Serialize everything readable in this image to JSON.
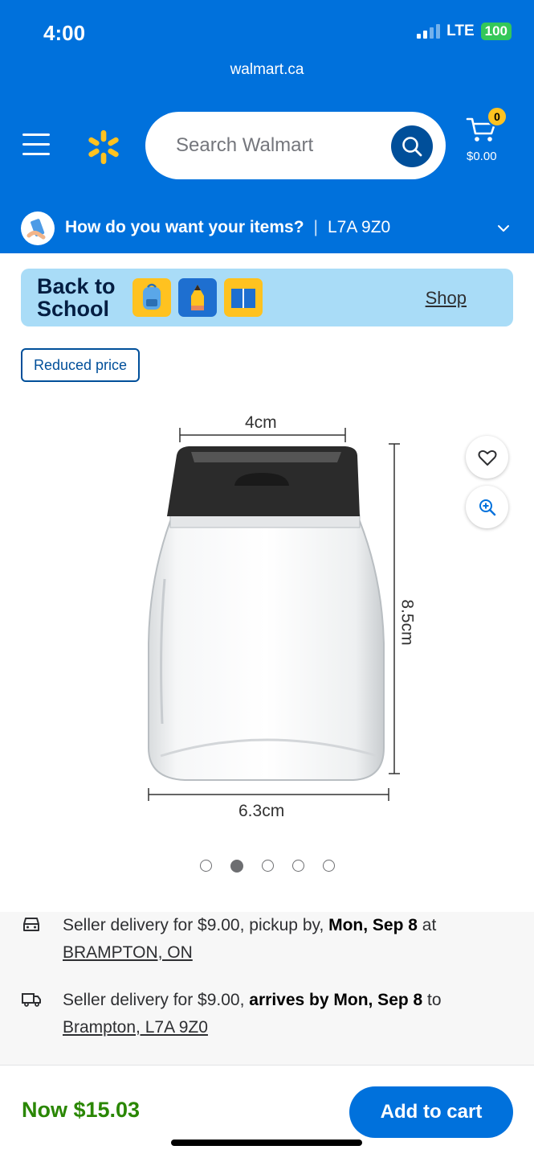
{
  "status_bar": {
    "time": "4:00",
    "network": "LTE",
    "battery": "100"
  },
  "browser": {
    "url": "walmart.ca"
  },
  "header": {
    "search_placeholder": "Search Walmart",
    "cart_count": "0",
    "cart_total": "$0.00",
    "delivery_question": "How do you want your items?",
    "delivery_separator": "|",
    "postal_code": "L7A 9Z0"
  },
  "banner": {
    "title_line1": "Back to",
    "title_line2": "School",
    "link": "Shop"
  },
  "product": {
    "badge": "Reduced price",
    "image_labels": {
      "width_top": "4cm",
      "height": "8.5cm",
      "width_bottom": "6.3cm"
    },
    "carousel_total": 5,
    "carousel_active": 2
  },
  "fulfillment": [
    {
      "icon": "pickup-car-icon",
      "prefix": "Seller delivery for $9.00, pickup by, ",
      "bold": "Mon, Sep 8",
      "suffix": " at",
      "link": "BRAMPTON, ON"
    },
    {
      "icon": "delivery-truck-icon",
      "prefix": "Seller delivery for $9.00, ",
      "bold": "arrives by Mon, Sep 8",
      "suffix": " to",
      "link": "Brampton, L7A 9Z0"
    }
  ],
  "footer": {
    "price": "Now $15.03",
    "add_to_cart": "Add to cart"
  },
  "colors": {
    "brand_blue": "#0071dc",
    "dark_blue": "#004f9a",
    "spark_yellow": "#ffc220",
    "price_green": "#2a8703",
    "banner_blue": "#a9dcf7"
  }
}
